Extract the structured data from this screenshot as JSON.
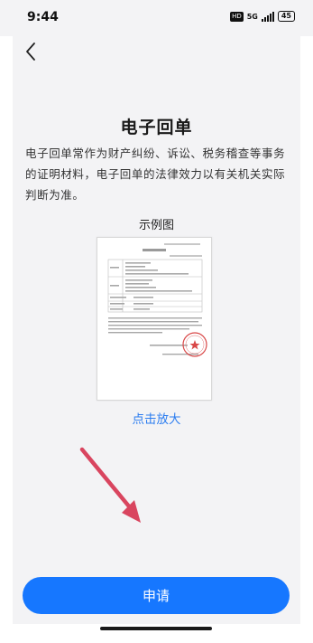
{
  "status_bar": {
    "time": "9:44",
    "hd_badge": "HD",
    "network": "5G",
    "battery": "45"
  },
  "page": {
    "title": "电子回单",
    "description": "电子回单常作为财产纠纷、诉讼、税务稽查等事务的证明材料，电子回单的法律效力以有关机关实际判断为准。",
    "example_label": "示例图",
    "zoom_link": "点击放大",
    "apply_button": "申请"
  },
  "icons": {
    "back": "chevron-left-icon",
    "arrow": "red-arrow-annotation"
  },
  "colors": {
    "background": "#f3f3f5",
    "primary": "#1677ff",
    "link": "#2c7df0",
    "annotation_arrow": "#d9455f",
    "stamp": "#d94848"
  }
}
